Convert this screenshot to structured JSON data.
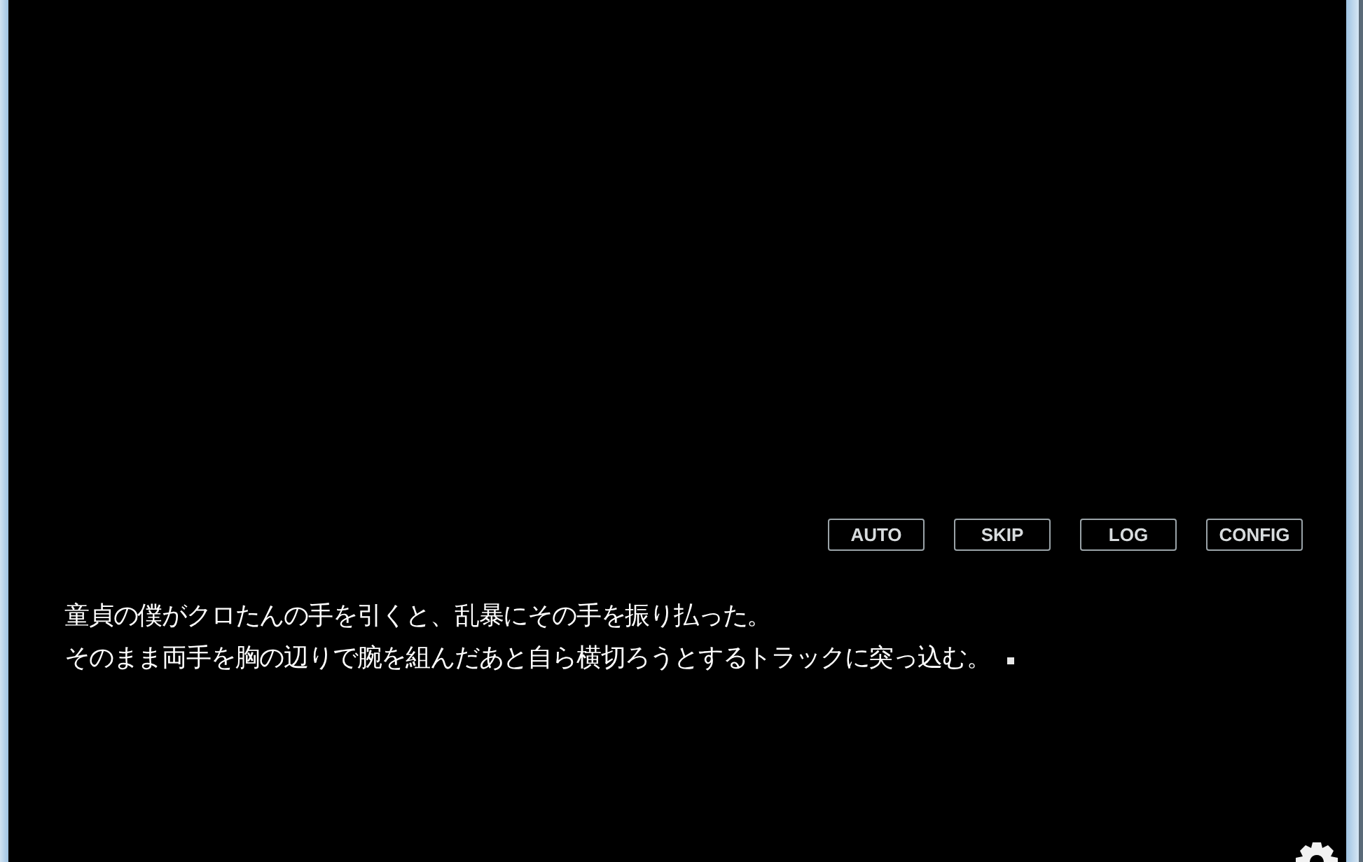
{
  "menu_buttons": [
    {
      "label": "AUTO"
    },
    {
      "label": "SKIP"
    },
    {
      "label": "LOG"
    },
    {
      "label": "CONFIG"
    }
  ],
  "message": {
    "lines": [
      "童貞の僕がクロたんの手を引くと、乱暴にその手を振り払った。",
      "そのまま両手を胸の辺りで腕を組んだあと自ら横切ろうとするトラックに突っ込む。"
    ]
  }
}
